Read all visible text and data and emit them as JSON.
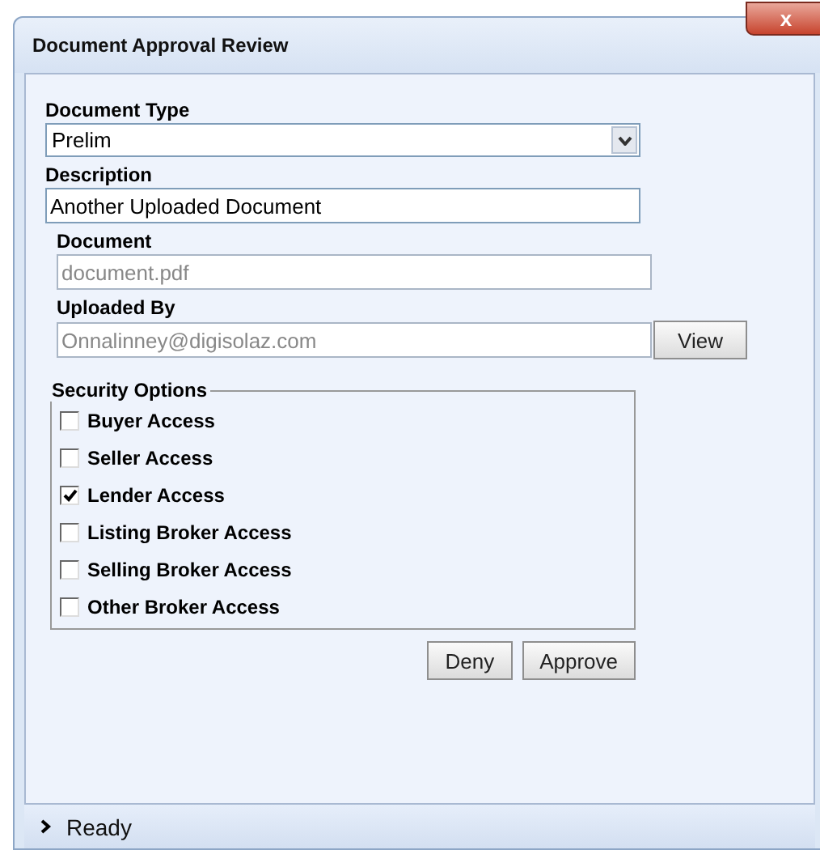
{
  "window": {
    "title": "Document Approval Review",
    "close": "x"
  },
  "form": {
    "document_type": {
      "label": "Document Type",
      "value": "Prelim"
    },
    "description": {
      "label": "Description",
      "value": "Another Uploaded Document"
    },
    "document": {
      "label": "Document",
      "value": "document.pdf",
      "disabled": true
    },
    "uploaded_by": {
      "label": "Uploaded By",
      "value": "Onnalinney@digisolaz.com",
      "disabled": true,
      "button": "View"
    }
  },
  "security_options": {
    "legend": "Security Options",
    "items": [
      {
        "label": "Buyer Access",
        "checked": false
      },
      {
        "label": "Seller Access",
        "checked": false
      },
      {
        "label": "Lender Access",
        "checked": true
      },
      {
        "label": "Listing Broker Access",
        "checked": false
      },
      {
        "label": "Selling Broker Access",
        "checked": false
      },
      {
        "label": "Other Broker Access",
        "checked": false
      }
    ]
  },
  "buttons": [
    "Deny",
    "Approve"
  ],
  "status_bar": {
    "text": "Ready"
  }
}
